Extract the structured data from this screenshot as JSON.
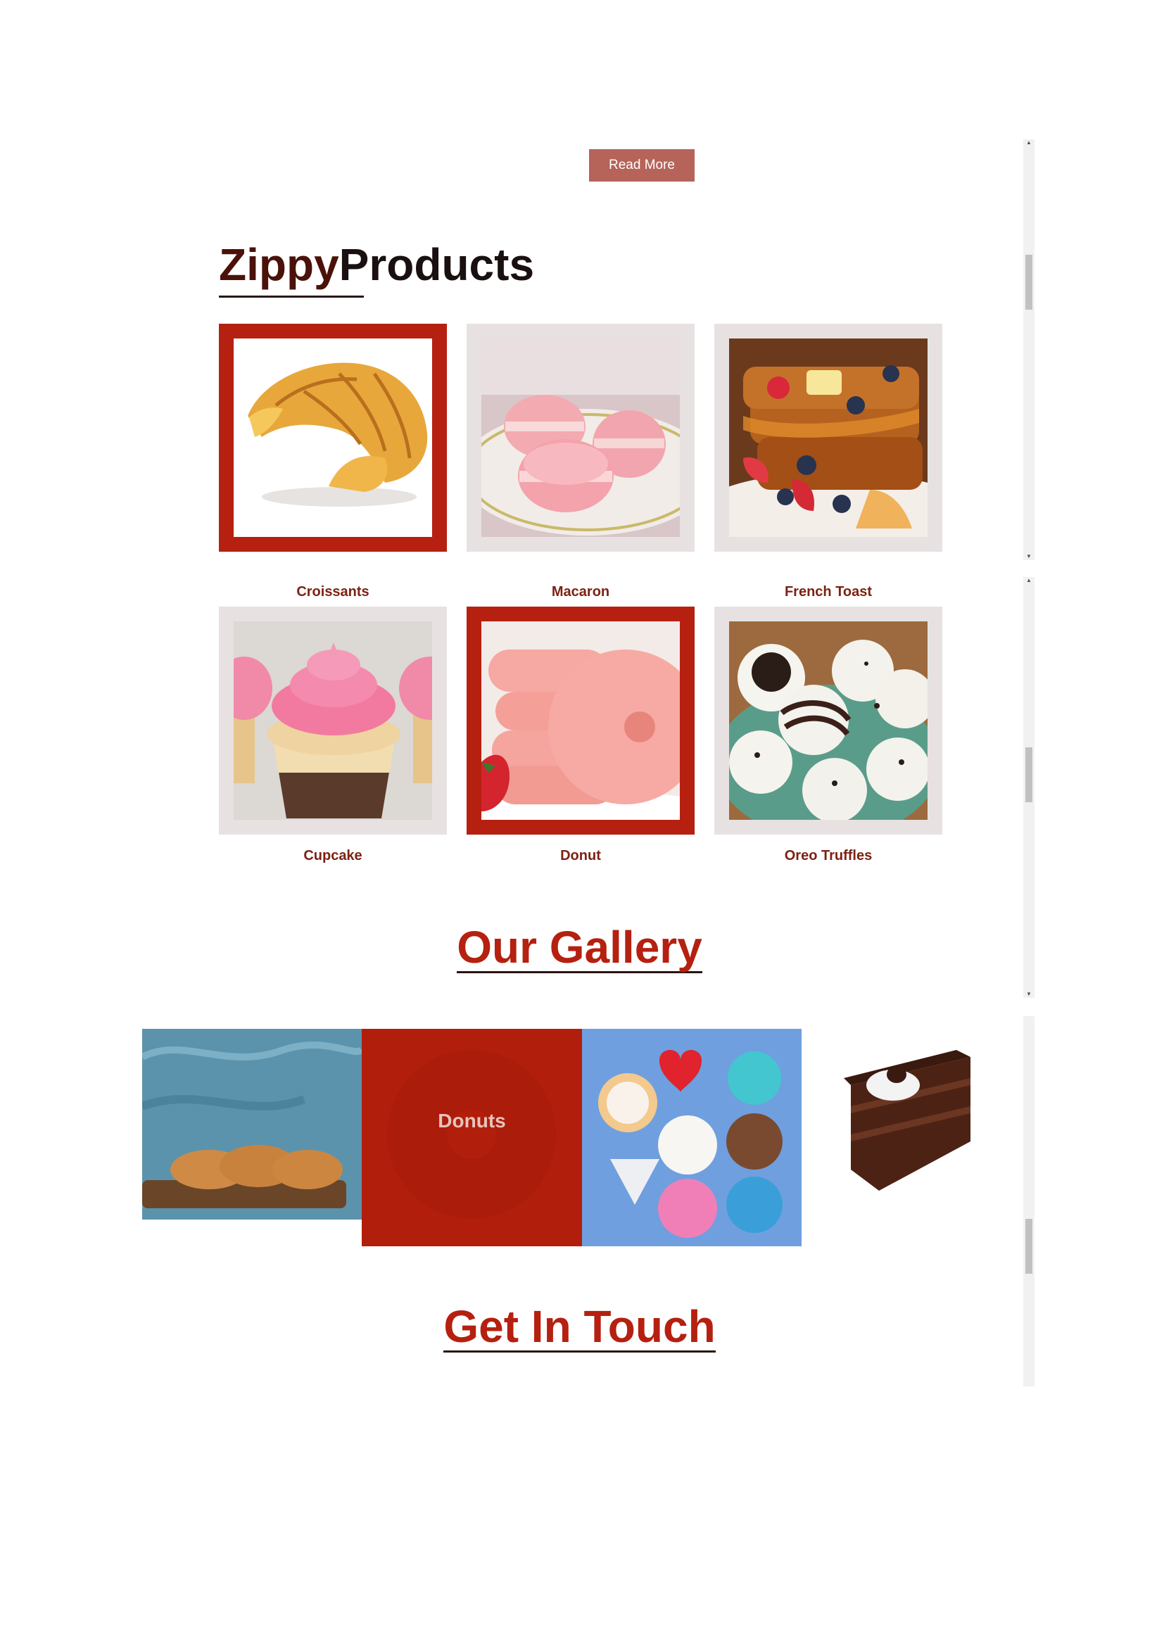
{
  "hero": {
    "read_more_label": "Read More"
  },
  "products": {
    "title_accent": "Zippy",
    "title_rest": "Products",
    "items": [
      {
        "label": "Croissants",
        "image": "croissant-image",
        "selected": true
      },
      {
        "label": "Macaron",
        "image": "macaron-image",
        "selected": false
      },
      {
        "label": "French Toast",
        "image": "french-toast-image",
        "selected": false
      },
      {
        "label": "Cupcake",
        "image": "cupcake-image",
        "selected": false
      },
      {
        "label": "Donut",
        "image": "donut-image",
        "selected": true
      },
      {
        "label": "Oreo Truffles",
        "image": "oreo-truffles-image",
        "selected": false
      }
    ]
  },
  "gallery": {
    "title": "Our Gallery",
    "items": [
      {
        "image": "croissants-board-image"
      },
      {
        "image": "glazed-donut-image",
        "caption": "Donuts"
      },
      {
        "image": "character-cookies-image"
      },
      {
        "image": "chocolate-cake-slice-image"
      }
    ]
  },
  "contact": {
    "title": "Get In Touch"
  },
  "colors": {
    "accent": "#b52010",
    "button": "#b6635a",
    "card_bg": "#e7e2e1",
    "label": "#7c2213",
    "title_dark": "#4a1209"
  }
}
